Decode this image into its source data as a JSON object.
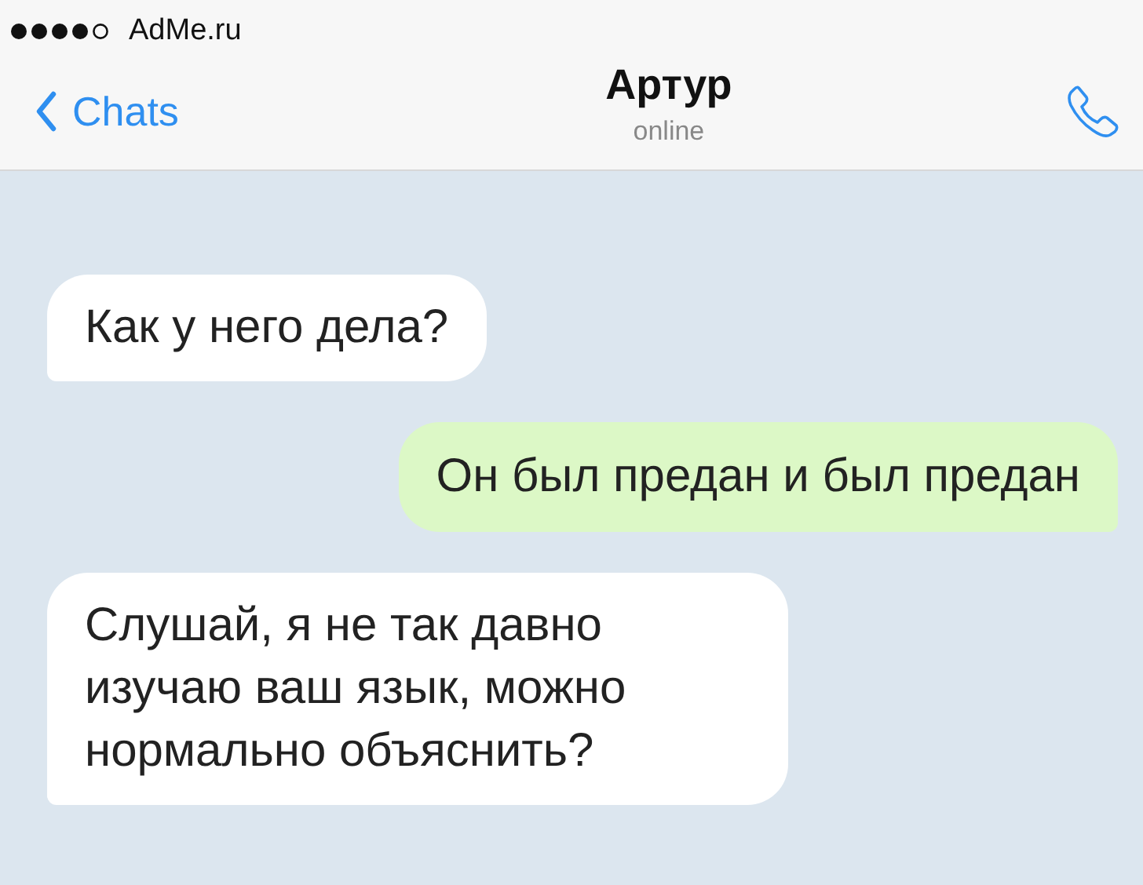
{
  "status_bar": {
    "carrier": "AdMe.ru"
  },
  "header": {
    "back": "Chats",
    "title": "Артур",
    "subtitle": "online"
  },
  "messages": [
    {
      "kind": "incoming",
      "text": "Как у него дела?"
    },
    {
      "kind": "outgoing",
      "text": "Он был предан и был предан"
    },
    {
      "kind": "incoming",
      "text": "Слушай, я не так давно изучаю ваш язык, можно нормально объяснить?"
    }
  ]
}
